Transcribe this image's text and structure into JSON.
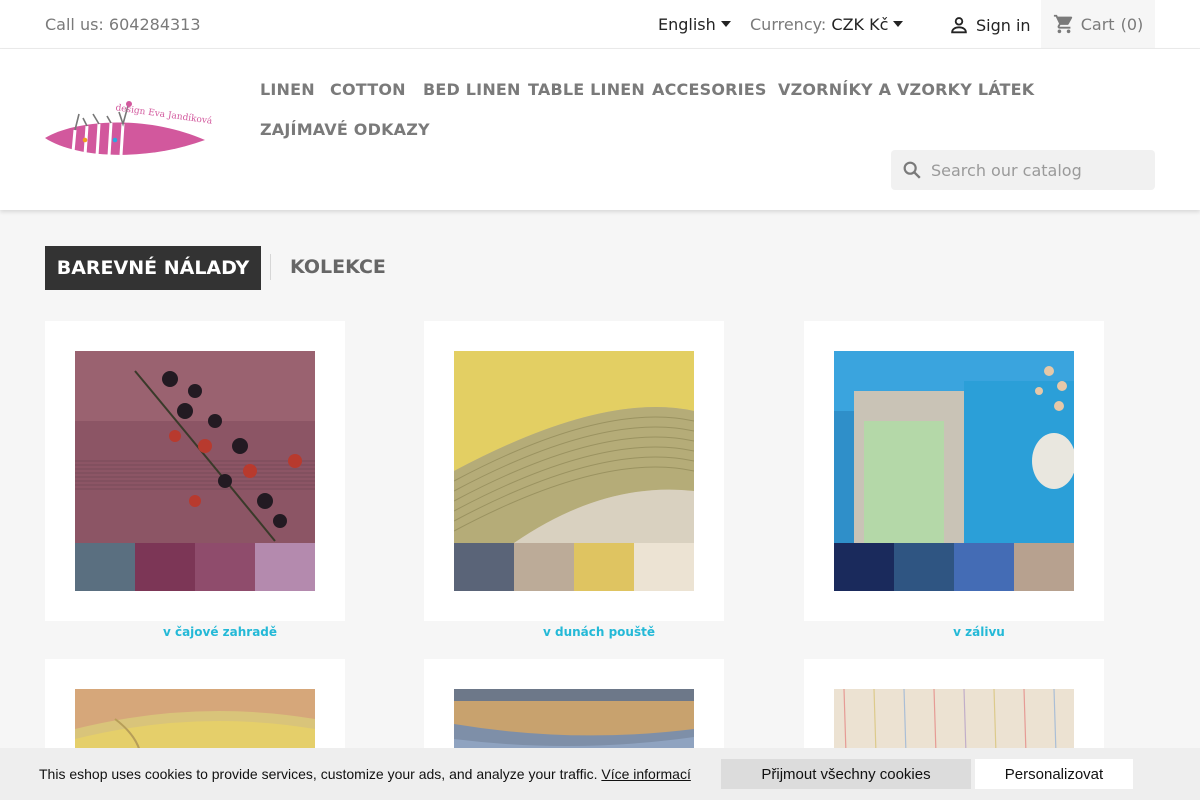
{
  "topbar": {
    "call_label": "Call us:",
    "phone": "604284313",
    "language": "English",
    "currency_label": "Currency:",
    "currency_value": "CZK Kč",
    "signin": "Sign in",
    "cart_label": "Cart",
    "cart_count": "(0)"
  },
  "logo": {
    "text": "design Eva Jandíková",
    "colors": {
      "primary": "#d2589d",
      "accent1": "#f0a020",
      "accent2": "#2aa8e0"
    }
  },
  "nav": {
    "items": [
      "LINEN",
      "COTTON",
      "BED LINEN",
      "TABLE LINEN",
      "ACCESORIES",
      "VZORNÍKY A VZORKY LÁTEK",
      "ZAJÍMAVÉ ODKAZY"
    ]
  },
  "search": {
    "placeholder": "Search our catalog"
  },
  "tabs": {
    "active": "BAREVNÉ NÁLADY",
    "inactive": "KOLEKCE"
  },
  "cards": [
    {
      "title": "v čajové zahradě",
      "swatches": [
        "#5a6f80",
        "#7c3656",
        "#8f4c6c",
        "#b48aae"
      ]
    },
    {
      "title": "v dunách pouště",
      "swatches": [
        "#5a6478",
        "#bcab98",
        "#dfc461",
        "#ece3d3"
      ]
    },
    {
      "title": "v zálivu",
      "swatches": [
        "#1a2a5c",
        "#2f5582",
        "#446cb5",
        "#b7a18f"
      ]
    },
    {
      "title": "",
      "swatches": []
    },
    {
      "title": "",
      "swatches": []
    },
    {
      "title": "",
      "swatches": []
    }
  ],
  "cookie": {
    "text": "This eshop uses cookies to provide services, customize your ads, and analyze your traffic.",
    "link": "Více informací",
    "accept": "Přijmout všechny cookies",
    "personalize": "Personalizovat"
  },
  "colors": {
    "link": "#24b9d7",
    "active_tab": "#333333"
  }
}
